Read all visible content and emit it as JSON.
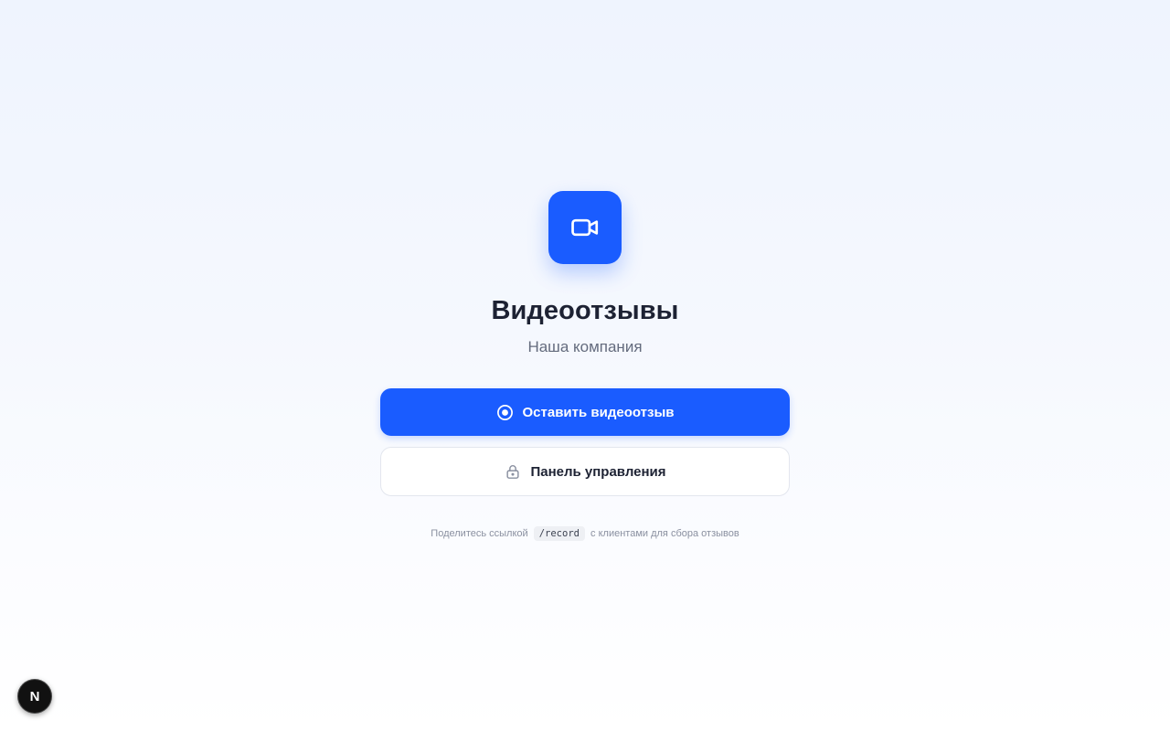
{
  "header": {
    "title": "Видеоотзывы",
    "subtitle": "Наша компания",
    "icon": "video-camera-icon"
  },
  "actions": {
    "record": {
      "label": "Оставить видеоотзыв",
      "icon": "record-icon"
    },
    "dashboard": {
      "label": "Панель управления",
      "icon": "lock-icon"
    }
  },
  "hint": {
    "before": "Поделитесь ссылкой",
    "code": "/record",
    "after": "с клиентами для сбора отзывов"
  },
  "dev_badge": {
    "letter": "N",
    "icon": "nextjs-logo-icon"
  },
  "colors": {
    "accent": "#1a5cff",
    "title": "#1d2233",
    "subtitle": "#646b7d",
    "hint": "#8a90a0"
  }
}
